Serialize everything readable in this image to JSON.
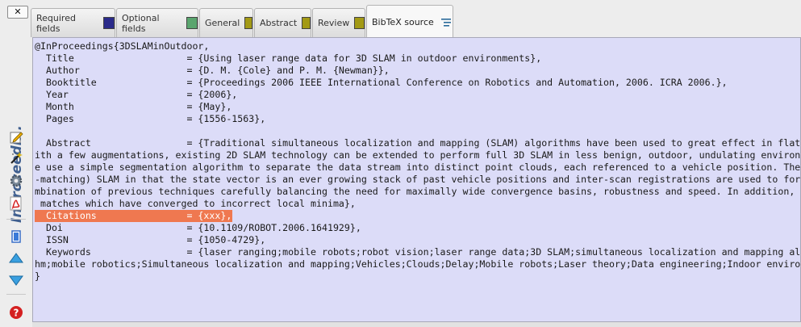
{
  "toolbar": {
    "close_label": "✕",
    "entry_type": "InProceedi...",
    "tools": [
      "edit-icon",
      "magic-wand-icon",
      "settings-gear-icon",
      "pdf-icon",
      "copy-icon",
      "move-up-icon",
      "move-down-icon",
      "help-icon"
    ]
  },
  "tabs": [
    {
      "label": "Required fields",
      "color": "#2a2a8a"
    },
    {
      "label": "Optional fields",
      "color": "#5aa56e"
    },
    {
      "label": "General",
      "color": "#a39a15"
    },
    {
      "label": "Abstract",
      "color": "#a39a15"
    },
    {
      "label": "Review",
      "color": "#a39a15"
    },
    {
      "label": "BibTeX source",
      "active": true
    }
  ],
  "source": {
    "highlight_color": "#ef7850",
    "lines": [
      "@InProceedings{3DSLAMinOutdoor,",
      "  Title                    = {Using laser range data for 3D SLAM in outdoor environments},",
      "  Author                   = {D. M. {Cole} and P. M. {Newman}},",
      "  Booktitle                = {Proceedings 2006 IEEE International Conference on Robotics and Automation, 2006. ICRA 2006.},",
      "  Year                     = {2006},",
      "  Month                    = {May},",
      "  Pages                    = {1556-1563},",
      "",
      "  Abstract                 = {Traditional simultaneous localization and mapping (SLAM) algorithms have been used to great effect in flat",
      "ith a few augmentations, existing 2D SLAM technology can be extended to perform full 3D SLAM in less benign, outdoor, undulating environ",
      "e use a simple segmentation algorithm to separate the data stream into distinct point clouds, each referenced to a vehicle position. The",
      "-matching) SLAM in that the state vector is an ever growing stack of past vehicle positions and inter-scan registrations are used to for",
      "mbination of previous techniques carefully balancing the need for maximally wide convergence basins, robustness and speed. In addition,",
      " matches which have converged to incorrect local minima},",
      "  Citations                = {xxx},",
      "  Doi                      = {10.1109/ROBOT.2006.1641929},",
      "  ISSN                     = {1050-4729},",
      "  Keywords                 = {laser ranging;mobile robots;robot vision;laser range data;3D SLAM;simultaneous localization and mapping al",
      "hm;mobile robotics;Simultaneous localization and mapping;Vehicles;Clouds;Delay;Mobile robots;Laser theory;Data engineering;Indoor enviro",
      "}"
    ],
    "highlighted_line": 14
  }
}
